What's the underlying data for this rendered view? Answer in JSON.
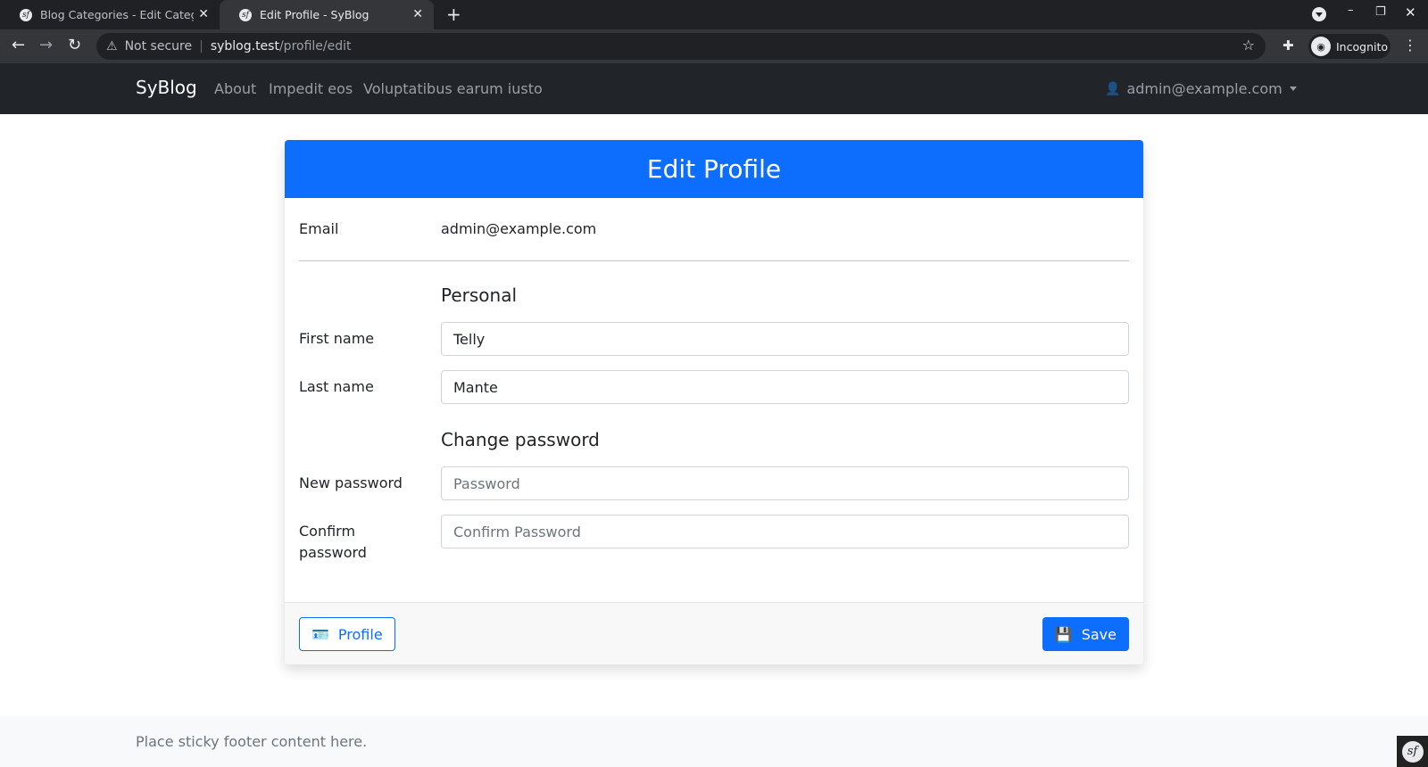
{
  "browser": {
    "tabs": [
      {
        "title": "Blog Categories - Edit Category",
        "active": false,
        "favicon": "symfony-icon"
      },
      {
        "title": "Edit Profile - SyBlog",
        "active": true,
        "favicon": "symfony-icon"
      }
    ],
    "new_tab_label": "+",
    "url_warning": "Not secure",
    "url_host": "syblog.test",
    "url_path": "/profile/edit",
    "incognito_label": "Incognito"
  },
  "navbar": {
    "brand": "SyBlog",
    "links": [
      "About",
      "Impedit eos",
      "Voluptatibus earum iusto"
    ],
    "user_email": "admin@example.com"
  },
  "card": {
    "title": "Edit Profile",
    "email_label": "Email",
    "email_value": "admin@example.com",
    "personal_heading": "Personal",
    "first_name_label": "First name",
    "first_name_value": "Telly",
    "last_name_label": "Last name",
    "last_name_value": "Mante",
    "password_heading": "Change password",
    "new_password_label": "New password",
    "new_password_placeholder": "Password",
    "confirm_password_label_line1": "Confirm",
    "confirm_password_label_line2": "password",
    "confirm_password_placeholder": "Confirm Password",
    "profile_button": "Profile",
    "save_button": "Save"
  },
  "footer": {
    "text": "Place sticky footer content here."
  },
  "colors": {
    "primary": "#0d6efd",
    "navbar_bg": "#212529",
    "chrome_dark": "#202124"
  }
}
